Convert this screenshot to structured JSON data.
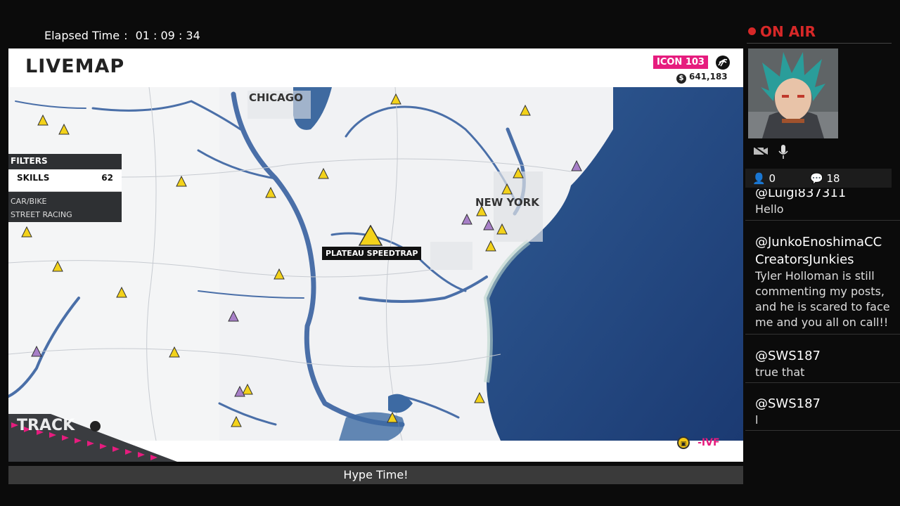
{
  "elapsed": {
    "label": "Elapsed Time",
    "value": "01 : 09 : 34"
  },
  "game": {
    "logo": "LIVEMAP",
    "icon_badge": "ICON 103",
    "credits": "641,183",
    "filters": {
      "title": "FILTERS",
      "selected": {
        "label": "SKILLS",
        "count": "62"
      },
      "items": [
        "CAR/BIKE",
        "STREET RACING"
      ]
    },
    "cities": [
      "CHICAGO",
      "NEW YORK"
    ],
    "poi_label": "PLATEAU SPEEDTRAP",
    "track_label": "TRACK",
    "bottom_right_label": "-IVF"
  },
  "hype_banner": "Hype Time!",
  "stream": {
    "status": "ON AIR",
    "viewers": "0",
    "comments": "18",
    "chat": [
      {
        "user": "@Luigi837311",
        "text": "Hello"
      },
      {
        "user": "@JunkoEnoshimaCCCreatorsJunkies",
        "text": "Tyler Holloman is still commenting my posts, and he is scared to face me and you all on call!!"
      },
      {
        "user": "@SWS187",
        "text": "true that"
      },
      {
        "user": "@SWS187",
        "text": "l"
      }
    ]
  }
}
